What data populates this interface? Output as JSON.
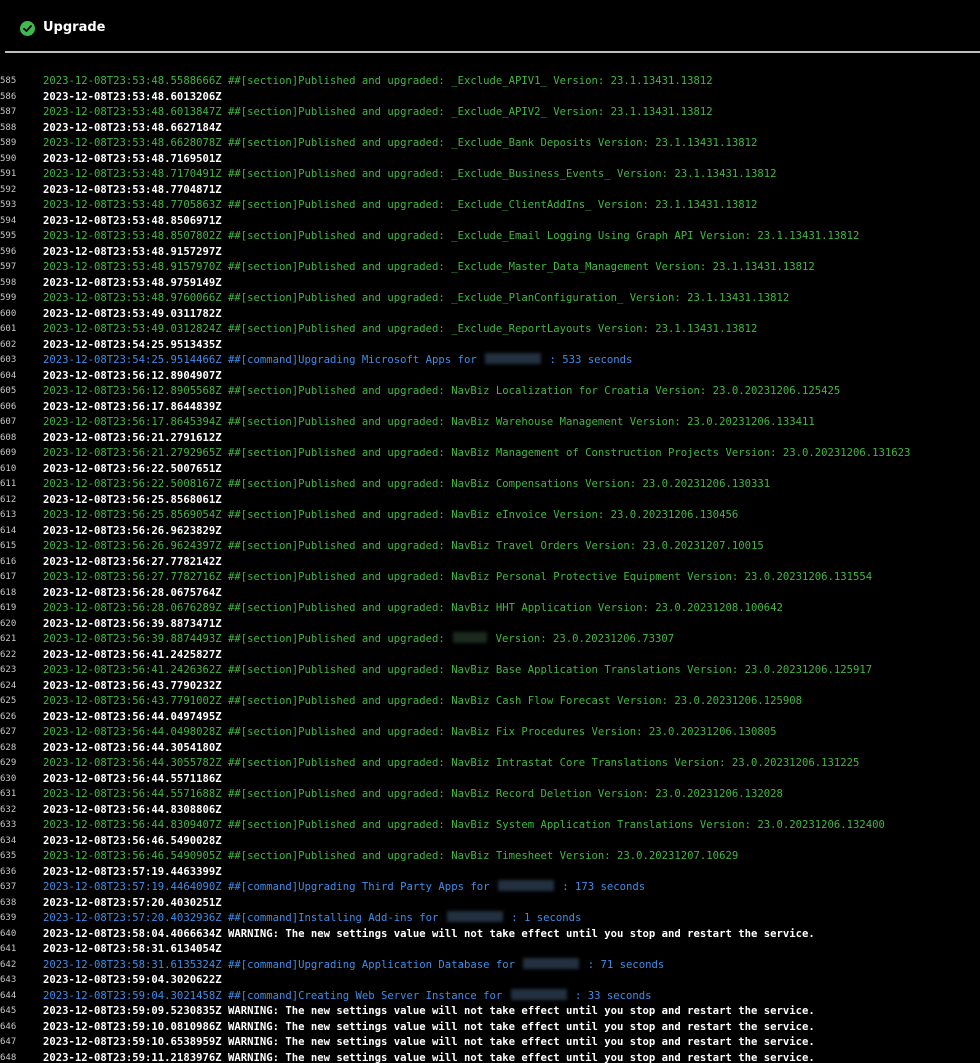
{
  "header": {
    "title": "Upgrade",
    "status_icon": "check-circle-icon",
    "status_color": "#3fb950"
  },
  "colors": {
    "section": "#3fb93f",
    "command": "#3b8eea",
    "plain": "#ffffff",
    "background": "#000000"
  },
  "log": [
    {
      "n": "585",
      "kind": "section",
      "text": "2023-12-08T23:53:48.5588666Z ##[section]Published and upgraded: _Exclude_APIV1_ Version: 23.1.13431.13812"
    },
    {
      "n": "586",
      "kind": "plain",
      "text": "2023-12-08T23:53:48.6013206Z"
    },
    {
      "n": "587",
      "kind": "section",
      "text": "2023-12-08T23:53:48.6013847Z ##[section]Published and upgraded: _Exclude_APIV2_ Version: 23.1.13431.13812"
    },
    {
      "n": "588",
      "kind": "plain",
      "text": "2023-12-08T23:53:48.6627184Z"
    },
    {
      "n": "589",
      "kind": "section",
      "text": "2023-12-08T23:53:48.6628078Z ##[section]Published and upgraded: _Exclude_Bank Deposits Version: 23.1.13431.13812"
    },
    {
      "n": "590",
      "kind": "plain",
      "text": "2023-12-08T23:53:48.7169501Z"
    },
    {
      "n": "591",
      "kind": "section",
      "text": "2023-12-08T23:53:48.7170491Z ##[section]Published and upgraded: _Exclude_Business_Events_ Version: 23.1.13431.13812"
    },
    {
      "n": "592",
      "kind": "plain",
      "text": "2023-12-08T23:53:48.7704871Z"
    },
    {
      "n": "593",
      "kind": "section",
      "text": "2023-12-08T23:53:48.7705863Z ##[section]Published and upgraded: _Exclude_ClientAddIns_ Version: 23.1.13431.13812"
    },
    {
      "n": "594",
      "kind": "plain",
      "text": "2023-12-08T23:53:48.8506971Z"
    },
    {
      "n": "595",
      "kind": "section",
      "text": "2023-12-08T23:53:48.8507802Z ##[section]Published and upgraded: _Exclude_Email Logging Using Graph API Version: 23.1.13431.13812"
    },
    {
      "n": "596",
      "kind": "plain",
      "text": "2023-12-08T23:53:48.9157297Z"
    },
    {
      "n": "597",
      "kind": "section",
      "text": "2023-12-08T23:53:48.9157970Z ##[section]Published and upgraded: _Exclude_Master_Data_Management Version: 23.1.13431.13812"
    },
    {
      "n": "598",
      "kind": "plain",
      "text": "2023-12-08T23:53:48.9759149Z"
    },
    {
      "n": "599",
      "kind": "section",
      "text": "2023-12-08T23:53:48.9760066Z ##[section]Published and upgraded: _Exclude_PlanConfiguration_ Version: 23.1.13431.13812"
    },
    {
      "n": "600",
      "kind": "plain",
      "text": "2023-12-08T23:53:49.0311782Z"
    },
    {
      "n": "601",
      "kind": "section",
      "text": "2023-12-08T23:53:49.0312824Z ##[section]Published and upgraded: _Exclude_ReportLayouts Version: 23.1.13431.13812"
    },
    {
      "n": "602",
      "kind": "plain",
      "text": "2023-12-08T23:54:25.9513435Z"
    },
    {
      "n": "603",
      "kind": "command",
      "text": "2023-12-08T23:54:25.9514466Z ##[command]Upgrading Microsoft Apps for",
      "redacted": true,
      "after": ": 533 seconds"
    },
    {
      "n": "604",
      "kind": "plain",
      "text": "2023-12-08T23:56:12.8904907Z"
    },
    {
      "n": "605",
      "kind": "section",
      "text": "2023-12-08T23:56:12.8905568Z ##[section]Published and upgraded: NavBiz Localization for Croatia Version: 23.0.20231206.125425"
    },
    {
      "n": "606",
      "kind": "plain",
      "text": "2023-12-08T23:56:17.8644839Z"
    },
    {
      "n": "607",
      "kind": "section",
      "text": "2023-12-08T23:56:17.8645394Z ##[section]Published and upgraded: NavBiz Warehouse Management Version: 23.0.20231206.133411"
    },
    {
      "n": "608",
      "kind": "plain",
      "text": "2023-12-08T23:56:21.2791612Z"
    },
    {
      "n": "609",
      "kind": "section",
      "text": "2023-12-08T23:56:21.2792965Z ##[section]Published and upgraded: NavBiz Management of Construction Projects Version: 23.0.20231206.131623"
    },
    {
      "n": "610",
      "kind": "plain",
      "text": "2023-12-08T23:56:22.5007651Z"
    },
    {
      "n": "611",
      "kind": "section",
      "text": "2023-12-08T23:56:22.5008167Z ##[section]Published and upgraded: NavBiz Compensations Version: 23.0.20231206.130331"
    },
    {
      "n": "612",
      "kind": "plain",
      "text": "2023-12-08T23:56:25.8568061Z"
    },
    {
      "n": "613",
      "kind": "section",
      "text": "2023-12-08T23:56:25.8569054Z ##[section]Published and upgraded: NavBiz eInvoice Version: 23.0.20231206.130456"
    },
    {
      "n": "614",
      "kind": "plain",
      "text": "2023-12-08T23:56:26.9623829Z"
    },
    {
      "n": "615",
      "kind": "section",
      "text": "2023-12-08T23:56:26.9624397Z ##[section]Published and upgraded: NavBiz Travel Orders Version: 23.0.20231207.10015"
    },
    {
      "n": "616",
      "kind": "plain",
      "text": "2023-12-08T23:56:27.7782142Z"
    },
    {
      "n": "617",
      "kind": "section",
      "text": "2023-12-08T23:56:27.7782716Z ##[section]Published and upgraded: NavBiz Personal Protective Equipment Version: 23.0.20231206.131554"
    },
    {
      "n": "618",
      "kind": "plain",
      "text": "2023-12-08T23:56:28.0675764Z"
    },
    {
      "n": "619",
      "kind": "section",
      "text": "2023-12-08T23:56:28.0676289Z ##[section]Published and upgraded: NavBiz HHT Application Version: 23.0.20231208.100642"
    },
    {
      "n": "620",
      "kind": "plain",
      "text": "2023-12-08T23:56:39.8873471Z"
    },
    {
      "n": "621",
      "kind": "section",
      "text": "2023-12-08T23:56:39.8874493Z ##[section]Published and upgraded:",
      "redacted": true,
      "after": "Version: 23.0.20231206.73307"
    },
    {
      "n": "622",
      "kind": "plain",
      "text": "2023-12-08T23:56:41.2425827Z"
    },
    {
      "n": "623",
      "kind": "section",
      "text": "2023-12-08T23:56:41.2426362Z ##[section]Published and upgraded: NavBiz Base Application Translations Version: 23.0.20231206.125917"
    },
    {
      "n": "624",
      "kind": "plain",
      "text": "2023-12-08T23:56:43.7790232Z"
    },
    {
      "n": "625",
      "kind": "section",
      "text": "2023-12-08T23:56:43.7791002Z ##[section]Published and upgraded: NavBiz Cash Flow Forecast Version: 23.0.20231206.125908"
    },
    {
      "n": "626",
      "kind": "plain",
      "text": "2023-12-08T23:56:44.0497495Z"
    },
    {
      "n": "627",
      "kind": "section",
      "text": "2023-12-08T23:56:44.0498028Z ##[section]Published and upgraded: NavBiz Fix Procedures Version: 23.0.20231206.130805"
    },
    {
      "n": "628",
      "kind": "plain",
      "text": "2023-12-08T23:56:44.3054180Z"
    },
    {
      "n": "629",
      "kind": "section",
      "text": "2023-12-08T23:56:44.3055782Z ##[section]Published and upgraded: NavBiz Intrastat Core Translations Version: 23.0.20231206.131225"
    },
    {
      "n": "630",
      "kind": "plain",
      "text": "2023-12-08T23:56:44.5571186Z"
    },
    {
      "n": "631",
      "kind": "section",
      "text": "2023-12-08T23:56:44.5571688Z ##[section]Published and upgraded: NavBiz Record Deletion Version: 23.0.20231206.132028"
    },
    {
      "n": "632",
      "kind": "plain",
      "text": "2023-12-08T23:56:44.8308806Z"
    },
    {
      "n": "633",
      "kind": "section",
      "text": "2023-12-08T23:56:44.8309407Z ##[section]Published and upgraded: NavBiz System Application Translations Version: 23.0.20231206.132400"
    },
    {
      "n": "634",
      "kind": "plain",
      "text": "2023-12-08T23:56:46.5490028Z"
    },
    {
      "n": "635",
      "kind": "section",
      "text": "2023-12-08T23:56:46.5490905Z ##[section]Published and upgraded: NavBiz Timesheet Version: 23.0.20231207.10629"
    },
    {
      "n": "636",
      "kind": "plain",
      "text": "2023-12-08T23:57:19.4463399Z"
    },
    {
      "n": "637",
      "kind": "command",
      "text": "2023-12-08T23:57:19.4464090Z ##[command]Upgrading Third Party Apps for",
      "redacted": true,
      "after": ": 173 seconds"
    },
    {
      "n": "638",
      "kind": "plain",
      "text": "2023-12-08T23:57:20.4030251Z"
    },
    {
      "n": "639",
      "kind": "command",
      "text": "2023-12-08T23:57:20.4032936Z ##[command]Installing Add-ins for",
      "redacted": true,
      "after": ": 1 seconds"
    },
    {
      "n": "640",
      "kind": "plain",
      "text": "2023-12-08T23:58:04.4066634Z WARNING: The new settings value will not take effect until you stop and restart the service."
    },
    {
      "n": "641",
      "kind": "plain",
      "text": "2023-12-08T23:58:31.6134054Z"
    },
    {
      "n": "642",
      "kind": "command",
      "text": "2023-12-08T23:58:31.6135324Z ##[command]Upgrading Application Database for",
      "redacted": true,
      "after": ": 71 seconds"
    },
    {
      "n": "643",
      "kind": "plain",
      "text": "2023-12-08T23:59:04.3020622Z"
    },
    {
      "n": "644",
      "kind": "command",
      "text": "2023-12-08T23:59:04.3021458Z ##[command]Creating Web Server Instance for",
      "redacted": true,
      "after": ": 33 seconds"
    },
    {
      "n": "645",
      "kind": "plain",
      "text": "2023-12-08T23:59:09.5230835Z WARNING: The new settings value will not take effect until you stop and restart the service."
    },
    {
      "n": "646",
      "kind": "plain",
      "text": "2023-12-08T23:59:10.0810986Z WARNING: The new settings value will not take effect until you stop and restart the service."
    },
    {
      "n": "647",
      "kind": "plain",
      "text": "2023-12-08T23:59:10.6538959Z WARNING: The new settings value will not take effect until you stop and restart the service."
    },
    {
      "n": "648",
      "kind": "plain",
      "text": "2023-12-08T23:59:11.2183976Z WARNING: The new settings value will not take effect until you stop and restart the service."
    }
  ]
}
